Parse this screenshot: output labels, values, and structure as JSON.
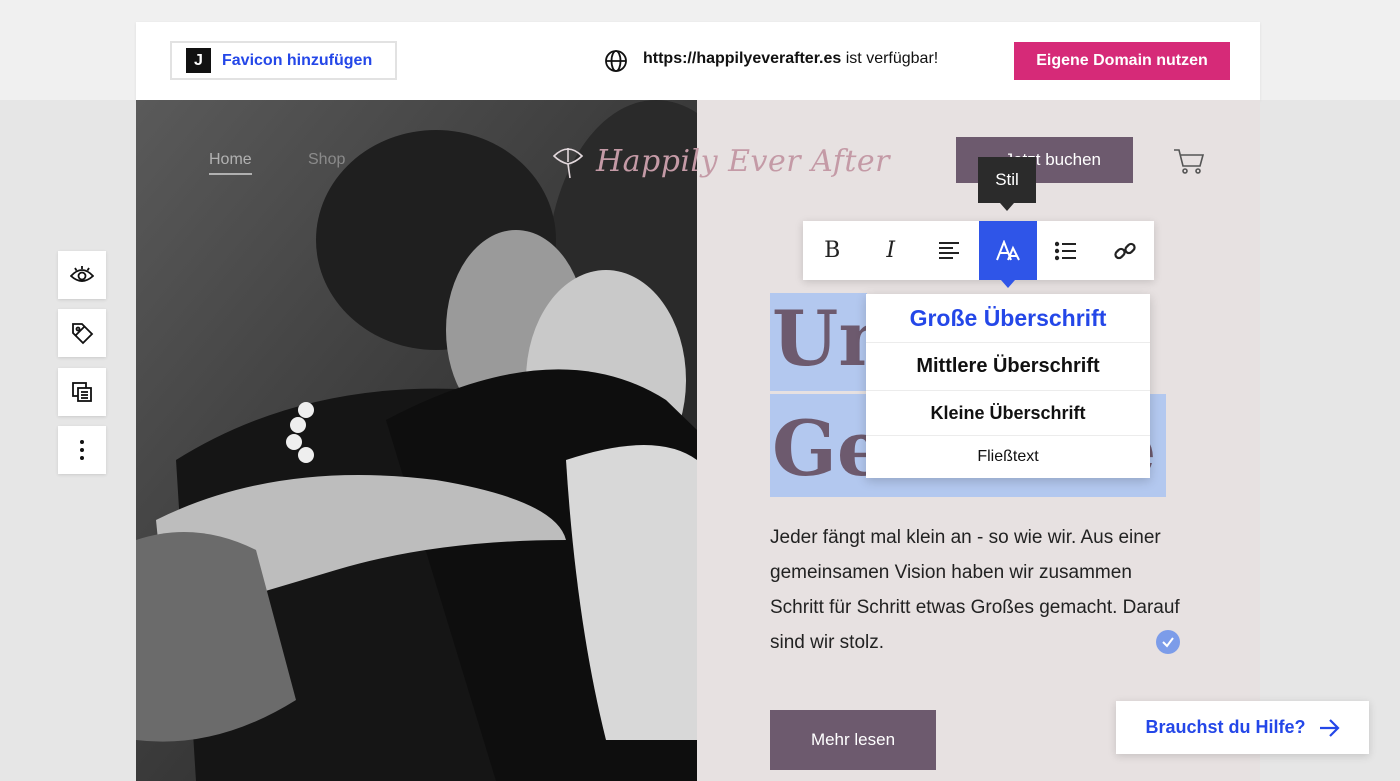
{
  "topbar": {
    "favicon_letter": "J",
    "favicon_label": "Favicon hinzufügen",
    "domain_url": "https://happilyeverafter.es",
    "domain_suffix": " ist verfügbar!",
    "domain_button": "Eigene Domain nutzen"
  },
  "site": {
    "nav": {
      "home": "Home",
      "shop": "Shop"
    },
    "logo_text": "Happily Ever After",
    "book_button": "Jetzt buchen",
    "headline_line1": "Un",
    "headline_line2": "Ge",
    "headline_tail": "e",
    "body_text": "Jeder fängt mal klein an - so wie wir. Aus einer gemeinsamen Vision haben wir zusammen Schritt für Schritt etwas Großes gemacht. Darauf sind wir stolz.",
    "more_button": "Mehr lesen"
  },
  "editor": {
    "tooltip": "Stil",
    "toolbar": [
      "bold-icon",
      "italic-icon",
      "align-left-icon",
      "text-style-icon",
      "list-icon",
      "link-icon"
    ],
    "style_menu": [
      "Große Überschrift",
      "Mittlere Überschrift",
      "Kleine Überschrift",
      "Fließtext"
    ]
  },
  "side_tools": [
    "eye-icon",
    "tag-icon",
    "copy-icon",
    "more-vertical-icon"
  ],
  "help": {
    "label": "Brauchst du Hilfe?"
  },
  "colors": {
    "accent_blue": "#2447e8",
    "domain_pink": "#d62a78",
    "mauve": "#6d5a6e",
    "selection": "#b3c8ef",
    "panel_bg": "#e7e1e1"
  }
}
